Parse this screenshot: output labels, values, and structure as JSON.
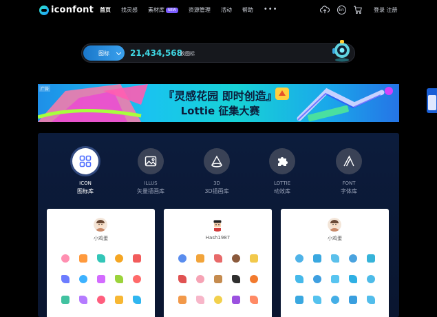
{
  "header": {
    "logo_text": "iconfont",
    "nav": [
      {
        "label": "首页",
        "active": true
      },
      {
        "label": "找灵感"
      },
      {
        "label": "素材库",
        "badge": "NEW"
      },
      {
        "label": "资源管理"
      },
      {
        "label": "活动"
      },
      {
        "label": "帮助"
      }
    ],
    "more": "•••",
    "auth_label": "登录 注册"
  },
  "search": {
    "type_label": "图标",
    "count": "21,434,568",
    "suffix": "枚图标"
  },
  "banner": {
    "tag": "广告",
    "title_line1": "『灵感花园 即时创造』",
    "title_line2": "Lottie 征集大赛"
  },
  "categories": [
    {
      "en": "ICON",
      "zh": "图标库",
      "icon": "grid-icon",
      "active": true
    },
    {
      "en": "ILLUS",
      "zh": "矢量插画库",
      "icon": "image-icon"
    },
    {
      "en": "3D",
      "zh": "3D插画库",
      "icon": "cone-icon"
    },
    {
      "en": "LOTTIE",
      "zh": "动效库",
      "icon": "puzzle-icon"
    },
    {
      "en": "FONT",
      "zh": "字体库",
      "icon": "letter-a-icon"
    }
  ],
  "cards": [
    {
      "author": "小鸡蛋",
      "palette": [
        "#ff8fb1",
        "#ff9a3d",
        "#33c6b8",
        "#f5a623",
        "#f25c5c",
        "#6c7cff",
        "#3db2ff",
        "#d36bff",
        "#9bd33b",
        "#ff6a6a",
        "#41c2a0",
        "#b57bff",
        "#ff5e7e",
        "#f7b733",
        "#30b6f0"
      ]
    },
    {
      "author": "Hash1987",
      "palette": [
        "#5a8dee",
        "#f2a43a",
        "#e86a6a",
        "#8b5a3c",
        "#f2c94c",
        "#e05252",
        "#f6a3b5",
        "#c58b4e",
        "#2f2f2f",
        "#f27a2e",
        "#f2994a",
        "#f7b6c9",
        "#f2d04c",
        "#9b51e0",
        "#ff8a65"
      ]
    },
    {
      "author": "小鸡蛋",
      "palette": [
        "#4fb3e8",
        "#3aa8e0",
        "#5bc0eb",
        "#4aa3df",
        "#36b3d9",
        "#46b9ea",
        "#3e9fe0",
        "#58c4f0",
        "#2fb0e4",
        "#4dbbe8",
        "#3aa8e0",
        "#55c2ee",
        "#44aee6",
        "#3a9fdf",
        "#52bdeb"
      ]
    }
  ]
}
